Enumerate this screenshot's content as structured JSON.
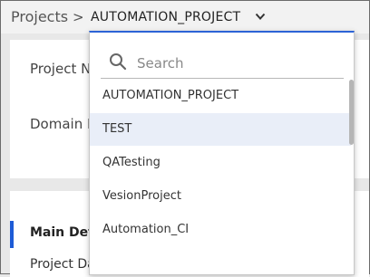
{
  "breadcrumb": {
    "root": "Projects",
    "separator": ">",
    "current_project": "AUTOMATION_PROJECT"
  },
  "details": {
    "project_name_label": "Project Na",
    "domain_name_label": "Domain N"
  },
  "nav": {
    "items": [
      {
        "label": "Main Deta",
        "active": true
      },
      {
        "label": "Project Database",
        "active": false
      }
    ]
  },
  "dropdown": {
    "search_placeholder": "Search",
    "options": [
      {
        "label": "AUTOMATION_PROJECT",
        "selected": false
      },
      {
        "label": "TEST",
        "selected": true
      },
      {
        "label": "QATesting",
        "selected": false
      },
      {
        "label": "VesionProject",
        "selected": false
      },
      {
        "label": "Automation_CI",
        "selected": false
      }
    ]
  },
  "colors": {
    "accent": "#2c63d6",
    "selected_row": "#e9eef8",
    "background": "#e8e8e8"
  }
}
